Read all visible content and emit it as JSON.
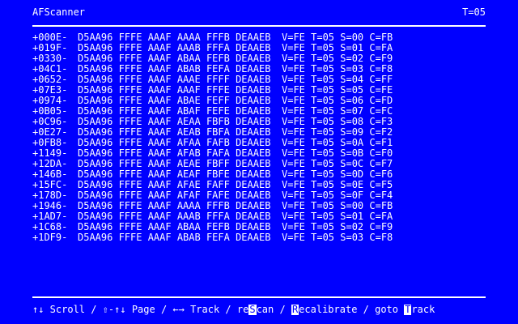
{
  "header": {
    "title": "AFScanner",
    "track": "T=05"
  },
  "rows": [
    {
      "offset": "+000E-",
      "hex": "D5AA96 FFFE AAAF AAAA FFFB DEAAEB",
      "status": "V=FE T=05 S=00 C=FB"
    },
    {
      "offset": "+019F-",
      "hex": "D5AA96 FFFE AAAF AAAB FFFA DEAAEB",
      "status": "V=FE T=05 S=01 C=FA"
    },
    {
      "offset": "+0330-",
      "hex": "D5AA96 FFFE AAAF ABAA FEFB DEAAEB",
      "status": "V=FE T=05 S=02 C=F9"
    },
    {
      "offset": "+04C1-",
      "hex": "D5AA96 FFFE AAAF ABAB FEFA DEAAEB",
      "status": "V=FE T=05 S=03 C=F8"
    },
    {
      "offset": "+0652-",
      "hex": "D5AA96 FFFE AAAF AAAE FFFF DEAAEB",
      "status": "V=FE T=05 S=04 C=FF"
    },
    {
      "offset": "+07E3-",
      "hex": "D5AA96 FFFE AAAF AAAF FFFE DEAAEB",
      "status": "V=FE T=05 S=05 C=FE"
    },
    {
      "offset": "+0974-",
      "hex": "D5AA96 FFFE AAAF ABAE FEFF DEAAEB",
      "status": "V=FE T=05 S=06 C=FD"
    },
    {
      "offset": "+0B05-",
      "hex": "D5AA96 FFFE AAAF ABAF FEFE DEAAEB",
      "status": "V=FE T=05 S=07 C=FC"
    },
    {
      "offset": "+0C96-",
      "hex": "D5AA96 FFFE AAAF AEAA FBFB DEAAEB",
      "status": "V=FE T=05 S=08 C=F3"
    },
    {
      "offset": "+0E27-",
      "hex": "D5AA96 FFFE AAAF AEAB FBFA DEAAEB",
      "status": "V=FE T=05 S=09 C=F2"
    },
    {
      "offset": "+0FB8-",
      "hex": "D5AA96 FFFE AAAF AFAA FAFB DEAAEB",
      "status": "V=FE T=05 S=0A C=F1"
    },
    {
      "offset": "+1149-",
      "hex": "D5AA96 FFFE AAAF AFAB FAFA DEAAEB",
      "status": "V=FE T=05 S=0B C=F0"
    },
    {
      "offset": "+12DA-",
      "hex": "D5AA96 FFFE AAAF AEAE FBFF DEAAEB",
      "status": "V=FE T=05 S=0C C=F7"
    },
    {
      "offset": "+146B-",
      "hex": "D5AA96 FFFE AAAF AEAF FBFE DEAAEB",
      "status": "V=FE T=05 S=0D C=F6"
    },
    {
      "offset": "+15FC-",
      "hex": "D5AA96 FFFE AAAF AFAE FAFF DEAAEB",
      "status": "V=FE T=05 S=0E C=F5"
    },
    {
      "offset": "+178D-",
      "hex": "D5AA96 FFFE AAAF AFAF FAFE DEAAEB",
      "status": "V=FE T=05 S=0F C=F4"
    },
    {
      "offset": "+1946-",
      "hex": "D5AA96 FFFE AAAF AAAA FFFB DEAAEB",
      "status": "V=FE T=05 S=00 C=FB"
    },
    {
      "offset": "+1AD7-",
      "hex": "D5AA96 FFFE AAAF AAAB FFFA DEAAEB",
      "status": "V=FE T=05 S=01 C=FA"
    },
    {
      "offset": "+1C68-",
      "hex": "D5AA96 FFFE AAAF ABAA FEFB DEAAEB",
      "status": "V=FE T=05 S=02 C=F9"
    },
    {
      "offset": "+1DF9-",
      "hex": "D5AA96 FFFE AAAF ABAB FEFA DEAAEB",
      "status": "V=FE T=05 S=03 C=F8"
    }
  ],
  "statusbar": {
    "scroll_arrows": "↑↓",
    "scroll": " Scroll / ",
    "page_arrows": "⇧-↑↓",
    "page": " Page / ",
    "track_arrows": "←→",
    "track": " Track / ",
    "rescan_pre": "re",
    "rescan_key": "S",
    "rescan_post": "can / ",
    "recal_key": "R",
    "recal_post": "ecalibrate / goto ",
    "goto_key": "T",
    "goto_post": "rack"
  },
  "colors": {
    "background": "#0000ff",
    "foreground": "#ffffff"
  }
}
